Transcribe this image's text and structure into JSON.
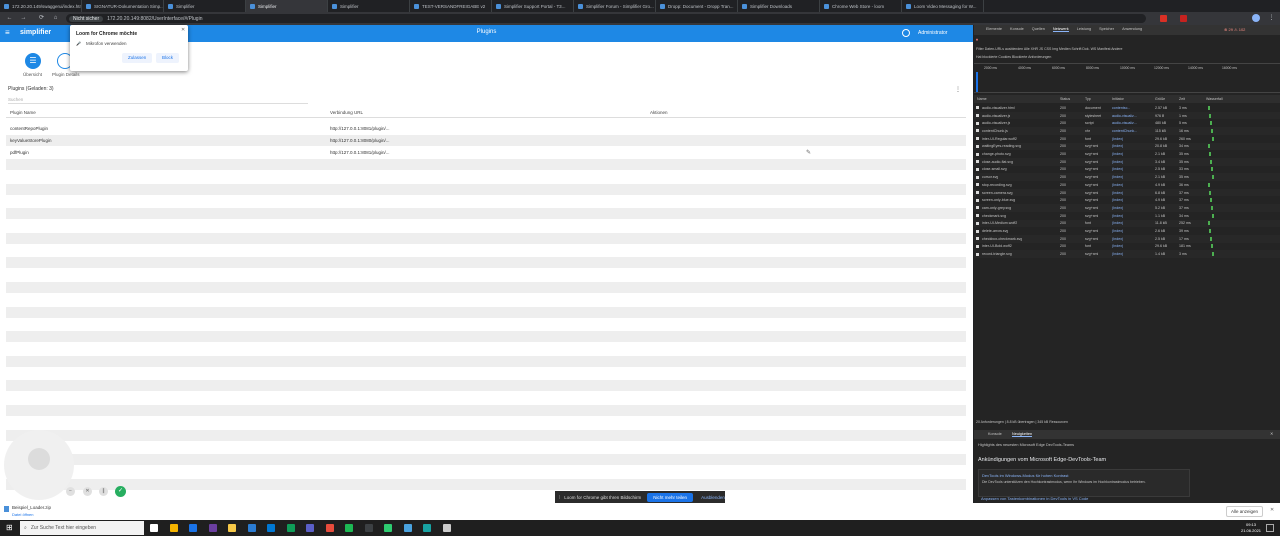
{
  "browser": {
    "tabs": [
      {
        "label": "172.20.20.149/swaggerui/index.html"
      },
      {
        "label": "SIGNATUR-Dokumentation Simp..."
      },
      {
        "label": "Simplifier"
      },
      {
        "label": "Simplifier"
      },
      {
        "label": "Simplifier"
      },
      {
        "label": "TEST-VERSANDFREIGABE v2"
      },
      {
        "label": "Simplifier Support Portal - T3..."
      },
      {
        "label": "Simplifier Forum - Simplifier Gro..."
      },
      {
        "label": "Dropp: Document - Dropp Tran..."
      },
      {
        "label": "Simplifier Downloads"
      },
      {
        "label": "Chrome Web Store - loom"
      },
      {
        "label": "Loom Video Messaging for W..."
      }
    ],
    "active_tab": 3,
    "security_chip": "Nicht sicher",
    "url": "172.20.20.149:8082/UserInterface/#/Plugin",
    "nav_back": "←",
    "nav_forward": "→",
    "nav_reload": "⟳"
  },
  "app": {
    "logo": "simplifier",
    "title": "Plugins",
    "user": "Administrator",
    "tabs": [
      {
        "label": "Übersicht"
      },
      {
        "label": "Plugin Details"
      }
    ],
    "section_title": "Plugins (Geladen: 3)",
    "search_placeholder": "Suchen",
    "table": {
      "headers": [
        "Plugin Name",
        "Verbindung URL",
        "Aktionen"
      ],
      "rows": [
        {
          "name": "contentRepoPlugin",
          "url": "http://127.0.0.1:8081/plugin/..."
        },
        {
          "name": "keyValueStorePlugin",
          "url": "http://127.0.0.1:8080/plugin/..."
        },
        {
          "name": "pdfPlugin",
          "url": "http://127.0.0.1:8081/plugin/..."
        }
      ]
    }
  },
  "loom_popup": {
    "title": "Loom for Chrome möchte",
    "permission": "Mikrofon verwenden",
    "allow": "Zulassen",
    "block": "Block"
  },
  "devtools": {
    "tabs": [
      "Elemente",
      "Konsole",
      "Quellen",
      "Netzwerk",
      "Leistung",
      "Speicher",
      "Anwendung"
    ],
    "active_tab": "Netzwerk",
    "counts": "⊗ 29  ⚠ 102",
    "filter_row": "Filter   Daten-URLs ausblenden   Alle   XHR  JS  CSS  Img  Medien  Schrift  Dok.  WS  Manifest  Andere",
    "blocked_row": "Hat blockierte Cookies   Blockierte Anforderungen",
    "timeline_ticks": [
      "2000 ms",
      "4000 ms",
      "6000 ms",
      "8000 ms",
      "10000 ms",
      "12000 ms",
      "14000 ms",
      "16000 ms"
    ],
    "columns": [
      "Name",
      "Status",
      "Typ",
      "Initiator",
      "Größe",
      "Zeit",
      "Wasserfall"
    ],
    "requests": [
      {
        "name": "audio-visualizer.html",
        "status": "200",
        "type": "document",
        "initiator": "contentsc...",
        "size": "2.57 kB",
        "time": "3 ms"
      },
      {
        "name": "audio-visualizer.js",
        "status": "200",
        "type": "stylesheet",
        "initiator": "audio-visualiz...",
        "size": "976 B",
        "time": "1 ms"
      },
      {
        "name": "audio-visualizer.js",
        "status": "200",
        "type": "script",
        "initiator": "audio-visualiz...",
        "size": "480 kB",
        "time": "5 ms"
      },
      {
        "name": "contentChunk.js",
        "status": "200",
        "type": "xhr",
        "initiator": "contentChunk...",
        "size": "115 kB",
        "time": "16 ms"
      },
      {
        "name": "inter-UI-Regular.woff2",
        "status": "200",
        "type": "font",
        "initiator": "(Index)",
        "size": "29.6 kB",
        "time": "260 ms"
      },
      {
        "name": "waitingEyes-reading.svg",
        "status": "200",
        "type": "svg+xml",
        "initiator": "(Index)",
        "size": "20.8 kB",
        "time": "34 ms"
      },
      {
        "name": "change-photo.svg",
        "status": "200",
        "type": "svg+xml",
        "initiator": "(Index)",
        "size": "2.1 kB",
        "time": "35 ms"
      },
      {
        "name": "close-audio-flat.svg",
        "status": "200",
        "type": "svg+xml",
        "initiator": "(Index)",
        "size": "3.4 kB",
        "time": "35 ms"
      },
      {
        "name": "close-small.svg",
        "status": "200",
        "type": "svg+xml",
        "initiator": "(Index)",
        "size": "2.5 kB",
        "time": "33 ms"
      },
      {
        "name": "cursor.svg",
        "status": "200",
        "type": "svg+xml",
        "initiator": "(Index)",
        "size": "2.1 kB",
        "time": "35 ms"
      },
      {
        "name": "stop-recording.svg",
        "status": "200",
        "type": "svg+xml",
        "initiator": "(Index)",
        "size": "4.9 kB",
        "time": "36 ms"
      },
      {
        "name": "screen-camera.svg",
        "status": "200",
        "type": "svg+xml",
        "initiator": "(Index)",
        "size": "6.8 kB",
        "time": "37 ms"
      },
      {
        "name": "screen-only-blue.svg",
        "status": "200",
        "type": "svg+xml",
        "initiator": "(Index)",
        "size": "4.9 kB",
        "time": "37 ms"
      },
      {
        "name": "cam-only-grey.svg",
        "status": "200",
        "type": "svg+xml",
        "initiator": "(Index)",
        "size": "5.2 kB",
        "time": "37 ms"
      },
      {
        "name": "checkmark.svg",
        "status": "200",
        "type": "svg+xml",
        "initiator": "(Index)",
        "size": "1.1 kB",
        "time": "34 ms"
      },
      {
        "name": "inter-UI-Medium.woff2",
        "status": "200",
        "type": "font",
        "initiator": "(Index)",
        "size": "11.8 kB",
        "time": "252 ms"
      },
      {
        "name": "delete-arrow.svg",
        "status": "200",
        "type": "svg+xml",
        "initiator": "(Index)",
        "size": "2.6 kB",
        "time": "39 ms"
      },
      {
        "name": "checkbox-checkmark.svg",
        "status": "200",
        "type": "svg+xml",
        "initiator": "(Index)",
        "size": "2.5 kB",
        "time": "17 ms"
      },
      {
        "name": "inter-UI-Bold.woff2",
        "status": "200",
        "type": "font",
        "initiator": "(Index)",
        "size": "29.6 kB",
        "time": "181 ms"
      },
      {
        "name": "record-triangle.svg",
        "status": "200",
        "type": "svg+xml",
        "initiator": "(Index)",
        "size": "1.4 kB",
        "time": "3 ms"
      }
    ],
    "summary": "20 Anforderungen  |  8.8 kB übertragen  |  345 kB Ressourcen",
    "drawer_tabs": [
      "Konsole",
      "Neuigkeiten"
    ],
    "drawer_active": "Neuigkeiten",
    "news_banner": "Highlights des neuesten Microsoft Edge DevTools-Teams",
    "news_heading": "Ankündigungen vom Microsoft Edge-DevTools-Team",
    "news_item_1_title": "DevTools im Windows-Modus für hohen Kontrast",
    "news_item_1_body": "Die DevTools unterstützen den Hochkontrastmodus, wenn Ihr Windows im Hochkontrastmodus betrieben.",
    "news_item_2_title": "Anpassen von Tastenkombinationen in DevTools in VS Code"
  },
  "screen_share_bar": {
    "text": "Loom for Chrome gibt Ihren Bildschirm",
    "stop": "Nicht mehr teilen",
    "hide": "Ausblenden"
  },
  "download_bar": {
    "file": "Beispiel_Loader.zip",
    "state": "Datei öffnen",
    "show_all": "Alle anzeigen"
  },
  "taskbar": {
    "search_placeholder": "Zur Suche Text hier eingeben",
    "time": "09:13",
    "date": "21.06.2021"
  }
}
